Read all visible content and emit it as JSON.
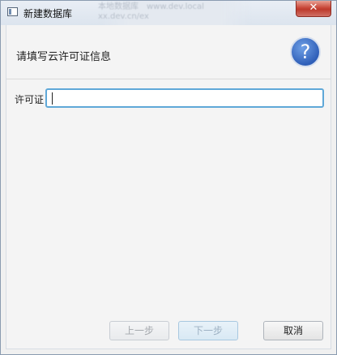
{
  "window": {
    "title": "新建数据库",
    "background_blur_lines": [
      "本地数据库　www.dev.local",
      "xx.dev.cn/ex"
    ]
  },
  "titlebar": {
    "close_label": "✕"
  },
  "header": {
    "instruction": "请填写云许可证信息",
    "help_glyph": "?"
  },
  "form": {
    "license_label": "许可证",
    "license_value": ""
  },
  "buttons": {
    "previous": "上一步",
    "next": "下一步",
    "cancel": "取消"
  },
  "colors": {
    "help_icon": "#2f5fb8",
    "input_focus_border": "#5fa8d8",
    "close_button": "#c9483a"
  }
}
